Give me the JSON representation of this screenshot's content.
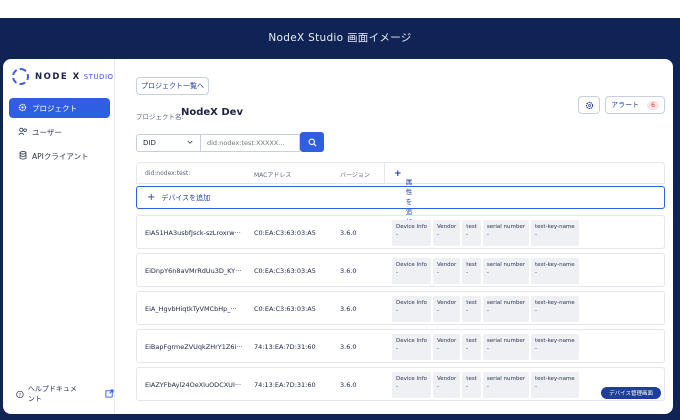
{
  "window": {
    "title": "NodeX Studio 画面イメージ"
  },
  "logo": {
    "brand": "NODE X",
    "product": "STUDIO"
  },
  "sidebar": {
    "items": [
      {
        "label": "プロジェクト",
        "icon": "gear-icon"
      },
      {
        "label": "ユーザー",
        "icon": "users-icon"
      },
      {
        "label": "APIクライアント",
        "icon": "database-icon"
      }
    ],
    "help": "ヘルプドキュメント"
  },
  "header": {
    "back_button": "プロジェクト一覧へ",
    "project_label": "プロジェクト名:",
    "project_name": "NodeX Dev",
    "alert_label": "アラート",
    "alert_count": "6"
  },
  "search": {
    "type_value": "DID",
    "placeholder": "did:nodex:test:XXXXX..."
  },
  "table": {
    "columns": [
      "did:nodex:test:",
      "MACアドレス",
      "バージョン"
    ],
    "add_attribute": "属性を追加",
    "add_device": "デバイスを追加",
    "attribute_labels": [
      "Device Info",
      "Vendor",
      "test",
      "serial number",
      "test-key-name"
    ],
    "attribute_empty": "-",
    "rows": [
      {
        "did": "EiA51HA3usbfJsck-szLroxrw···",
        "mac": "C0:EA:C3:63:03:A5",
        "version": "3.6.0"
      },
      {
        "did": "EiDnpY6n8aVMrRdUu3D_KY···",
        "mac": "C0:EA:C3:63:03:A5",
        "version": "3.6.0"
      },
      {
        "did": "EiA_HgvbHiqtkTyVMCbHp_···",
        "mac": "C0:EA:C3:63:03:A5",
        "version": "3.6.0"
      },
      {
        "did": "EiBapFgrmeZVUqkZHrY1Z6i···",
        "mac": "74:13:EA:7D:31:60",
        "version": "3.6.0"
      },
      {
        "did": "EiAZYFbAyl24OeXluODCXUI···",
        "mac": "74:13:EA:7D:31:60",
        "version": "3.6.0"
      }
    ]
  },
  "watermark": "デバイス管理画面",
  "colors": {
    "accent": "#2f5fe0",
    "frame": "#0f2454",
    "alert": "#d33333"
  }
}
